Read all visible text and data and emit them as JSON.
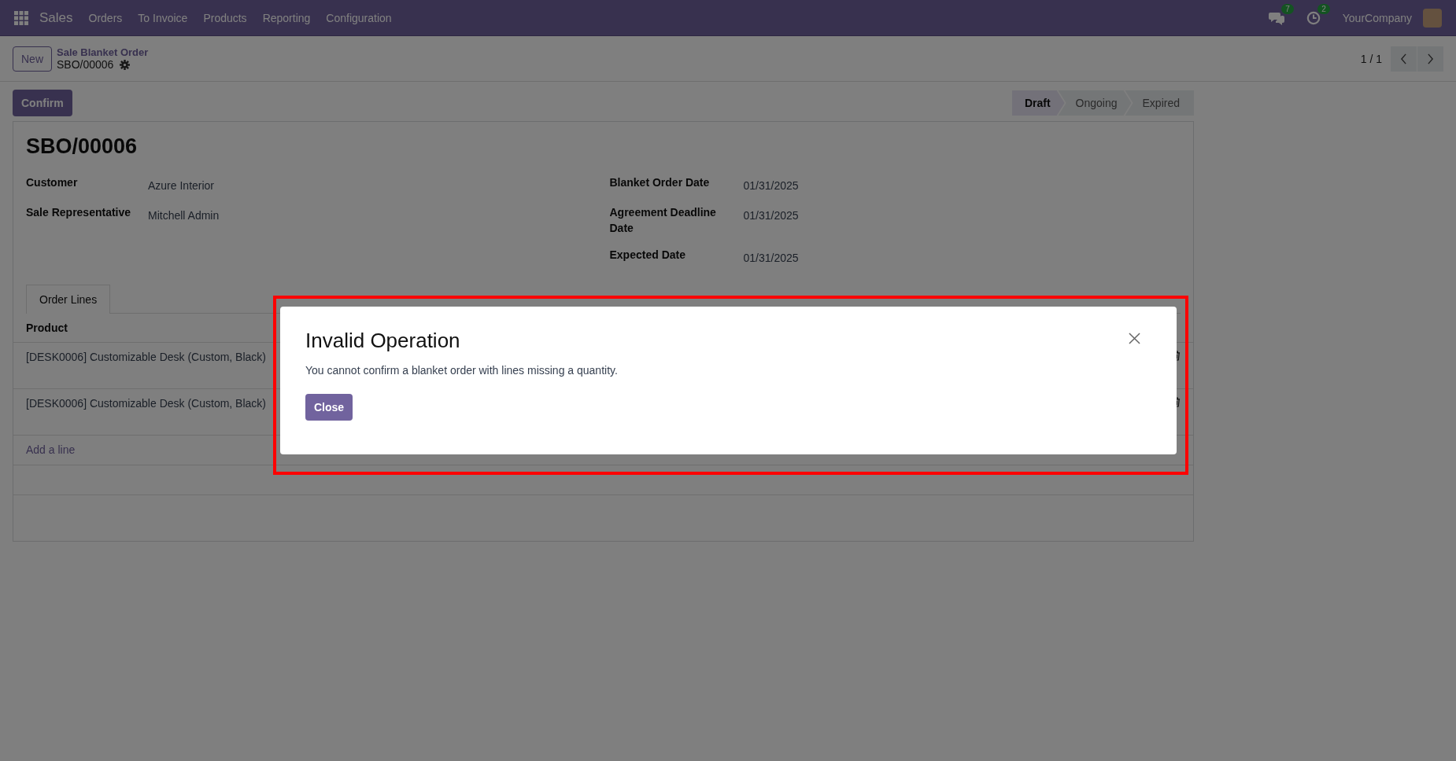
{
  "navbar": {
    "app_name": "Sales",
    "menu": [
      "Orders",
      "To Invoice",
      "Products",
      "Reporting",
      "Configuration"
    ],
    "messages_badge": "7",
    "activities_badge": "2",
    "company": "YourCompany"
  },
  "control_panel": {
    "new_button": "New",
    "breadcrumb": "Sale Blanket Order",
    "record": "SBO/00006",
    "pager": "1 / 1"
  },
  "confirm_button": "Confirm",
  "status_steps": [
    {
      "label": "Draft",
      "selected": true
    },
    {
      "label": "Ongoing",
      "selected": false
    },
    {
      "label": "Expired",
      "selected": false
    }
  ],
  "form": {
    "title": "SBO/00006",
    "left_fields": [
      {
        "label": "Customer",
        "value": "Azure Interior"
      },
      {
        "label": "Sale Representative",
        "value": "Mitchell Admin"
      }
    ],
    "right_fields": [
      {
        "label": "Blanket Order Date",
        "value": "01/31/2025"
      },
      {
        "label": "Agreement Deadline Date",
        "value": "01/31/2025"
      },
      {
        "label": "Expected Date",
        "value": "01/31/2025"
      }
    ]
  },
  "tabs": [
    {
      "label": "Order Lines",
      "selected": true
    }
  ],
  "table": {
    "columns": [
      "Product"
    ],
    "rows": [
      {
        "product": "[DESK0006] Customizable Desk (Custom, Black)"
      },
      {
        "product": "[DESK0006] Customizable Desk (Custom, Black)"
      }
    ],
    "add_line": "Add a line"
  },
  "dialog": {
    "title": "Invalid Operation",
    "message": "You cannot confirm a blanket order with lines missing a quantity.",
    "button": "Close",
    "highlighted": true
  }
}
